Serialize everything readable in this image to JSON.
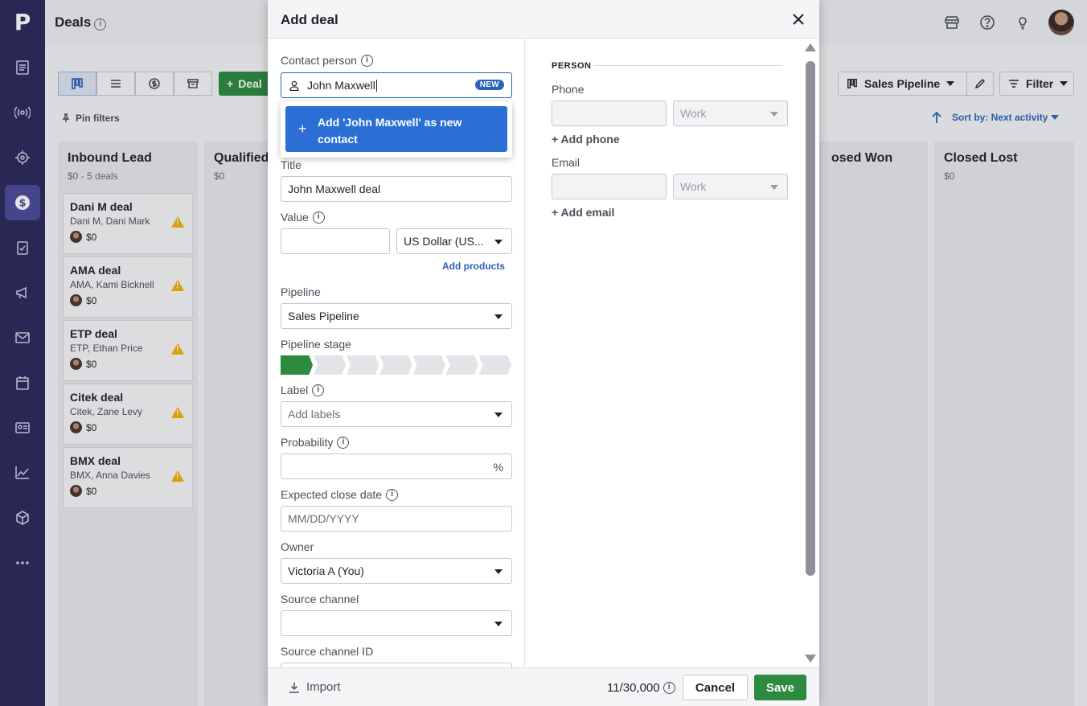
{
  "app": {
    "logo": "P",
    "title": "Deals"
  },
  "toolbar": {
    "add_deal_label": "Deal",
    "pin_filters_label": "Pin filters",
    "pipeline_label": "Sales Pipeline",
    "filter_label": "Filter",
    "sort_label": "Sort by: Next activity"
  },
  "board": {
    "columns": [
      {
        "title": "Inbound Lead",
        "sub": "$0 - 5 deals"
      },
      {
        "title": "Qualified",
        "sub": "$0"
      },
      {
        "title": "osed Won",
        "sub": ""
      },
      {
        "title": "Closed Lost",
        "sub": "$0"
      }
    ],
    "deals": [
      {
        "title": "Dani M deal",
        "sub": "Dani M, Dani Mark",
        "value": "$0"
      },
      {
        "title": "AMA deal",
        "sub": "AMA, Kami Bicknell",
        "value": "$0"
      },
      {
        "title": "ETP deal",
        "sub": "ETP, Ethan Price",
        "value": "$0"
      },
      {
        "title": "Citek deal",
        "sub": "Citek, Zane Levy",
        "value": "$0"
      },
      {
        "title": "BMX deal",
        "sub": "BMX, Anna Davies",
        "value": "$0"
      }
    ]
  },
  "modal": {
    "title": "Add deal",
    "contact_label": "Contact person",
    "contact_value": "John Maxwell",
    "new_badge": "NEW",
    "dropdown_option": "Add 'John Maxwell' as new contact",
    "title_label": "Title",
    "title_value": "John Maxwell deal",
    "value_label": "Value",
    "value_value": "",
    "currency": "US Dollar (US...",
    "add_products": "Add products",
    "pipeline_label": "Pipeline",
    "pipeline_value": "Sales Pipeline",
    "stage_label": "Pipeline stage",
    "stages_total": 7,
    "stage_current": 1,
    "label_label": "Label",
    "label_placeholder": "Add labels",
    "probability_label": "Probability",
    "probability_unit": "%",
    "close_date_label": "Expected close date",
    "close_date_placeholder": "MM/DD/YYYY",
    "owner_label": "Owner",
    "owner_value": "Victoria A (You)",
    "source_channel_label": "Source channel",
    "source_channel_value": "",
    "source_channel_id_label": "Source channel ID",
    "person_section": "PERSON",
    "phone_label": "Phone",
    "phone_type": "Work",
    "add_phone": "+ Add phone",
    "email_label": "Email",
    "email_type": "Work",
    "add_email": "+ Add email",
    "import_label": "Import",
    "counter": "11/30,000",
    "cancel_label": "Cancel",
    "save_label": "Save"
  },
  "colors": {
    "sidebar": "#2b2a5b",
    "accent_green": "#2d8a3f",
    "accent_blue": "#2a63b8",
    "warning": "#f0b400"
  },
  "icons": {
    "sidebar": [
      "leads-icon",
      "broadcast-icon",
      "target-icon",
      "deals-icon",
      "tasks-icon",
      "megaphone-icon",
      "mail-icon",
      "calendar-icon",
      "contacts-icon",
      "chart-icon",
      "box-icon",
      "more-icon"
    ]
  }
}
